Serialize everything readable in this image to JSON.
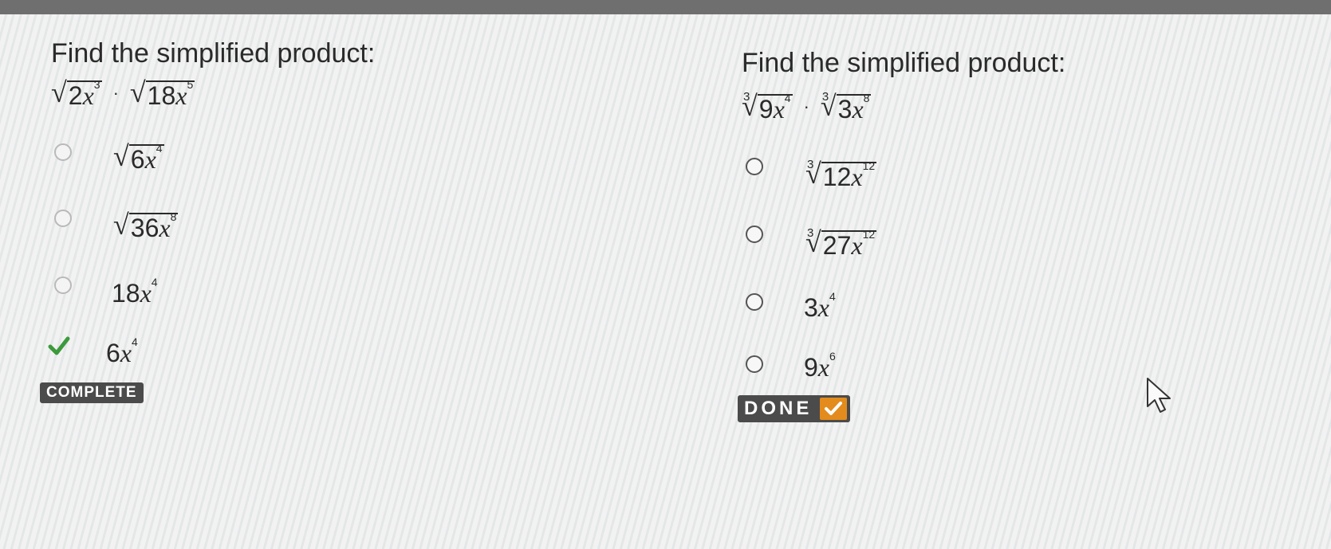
{
  "colors": {
    "accent_orange": "#e38b1c",
    "badge_bg": "#4b4b4b",
    "check_green": "#3c9a3c"
  },
  "left": {
    "title": "Find the simplified product:",
    "expr": {
      "a_num": "2",
      "a_var": "x",
      "a_exp": "3",
      "dot": "·",
      "b_num": "18",
      "b_var": "x",
      "b_exp": "5"
    },
    "options": [
      {
        "radical": true,
        "index": "",
        "num": "6",
        "var": "x",
        "exp": "4",
        "state": "radio"
      },
      {
        "radical": true,
        "index": "",
        "num": "36",
        "var": "x",
        "exp": "8",
        "state": "radio"
      },
      {
        "radical": false,
        "num": "18",
        "var": "x",
        "exp": "4",
        "state": "radio"
      },
      {
        "radical": false,
        "num": "6",
        "var": "x",
        "exp": "4",
        "state": "correct"
      }
    ],
    "status_label": "COMPLETE"
  },
  "right": {
    "title": "Find the simplified product:",
    "expr": {
      "index": "3",
      "a_num": "9",
      "a_var": "x",
      "a_exp": "4",
      "dot": "·",
      "b_num": "3",
      "b_var": "x",
      "b_exp": "8"
    },
    "options": [
      {
        "radical": true,
        "index": "3",
        "num": "12",
        "var": "x",
        "exp": "12",
        "state": "radio"
      },
      {
        "radical": true,
        "index": "3",
        "num": "27",
        "var": "x",
        "exp": "12",
        "state": "radio"
      },
      {
        "radical": false,
        "num": "3",
        "var": "x",
        "exp": "4",
        "state": "radio"
      },
      {
        "radical": false,
        "num": "9",
        "var": "x",
        "exp": "6",
        "state": "radio"
      }
    ],
    "done_label": "DONE"
  }
}
